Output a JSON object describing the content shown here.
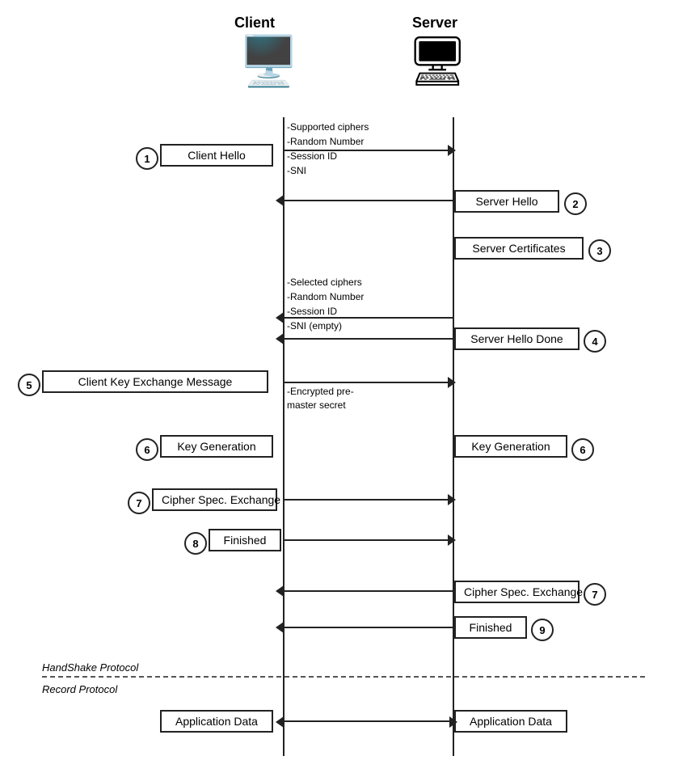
{
  "header": {
    "client_label": "Client",
    "server_label": "Server"
  },
  "steps": [
    {
      "id": "1",
      "label": "Client Hello"
    },
    {
      "id": "2",
      "label": "Server Hello"
    },
    {
      "id": "3",
      "label": "Server Certificates"
    },
    {
      "id": "4",
      "label": "Server Hello Done"
    },
    {
      "id": "5",
      "label": "Client Key Exchange Message"
    },
    {
      "id": "6a",
      "label": "Key Generation"
    },
    {
      "id": "6b",
      "label": "Key Generation"
    },
    {
      "id": "7a",
      "label": "Cipher Spec. Exchange"
    },
    {
      "id": "8",
      "label": "Finished"
    },
    {
      "id": "7b",
      "label": "Cipher Spec. Exchange"
    },
    {
      "id": "9",
      "label": "Finished"
    },
    {
      "id": "apd_client",
      "label": "Application Data"
    },
    {
      "id": "apd_server",
      "label": "Application Data"
    }
  ],
  "annotations": {
    "client_hello": "-Supported ciphers\n-Random Number\n-Session ID\n-SNI",
    "server_certs": "-Selected ciphers\n-Random Number\n-Session ID\n-SNI (empty)",
    "encrypted": "-Encrypted pre-\nmaster secret"
  },
  "protocols": {
    "handshake": "HandShake Protocol",
    "record": "Record Protocol"
  },
  "numbers": {
    "step_circles": [
      "1",
      "2",
      "3",
      "4",
      "5",
      "6",
      "6",
      "7",
      "8",
      "7",
      "9"
    ]
  }
}
